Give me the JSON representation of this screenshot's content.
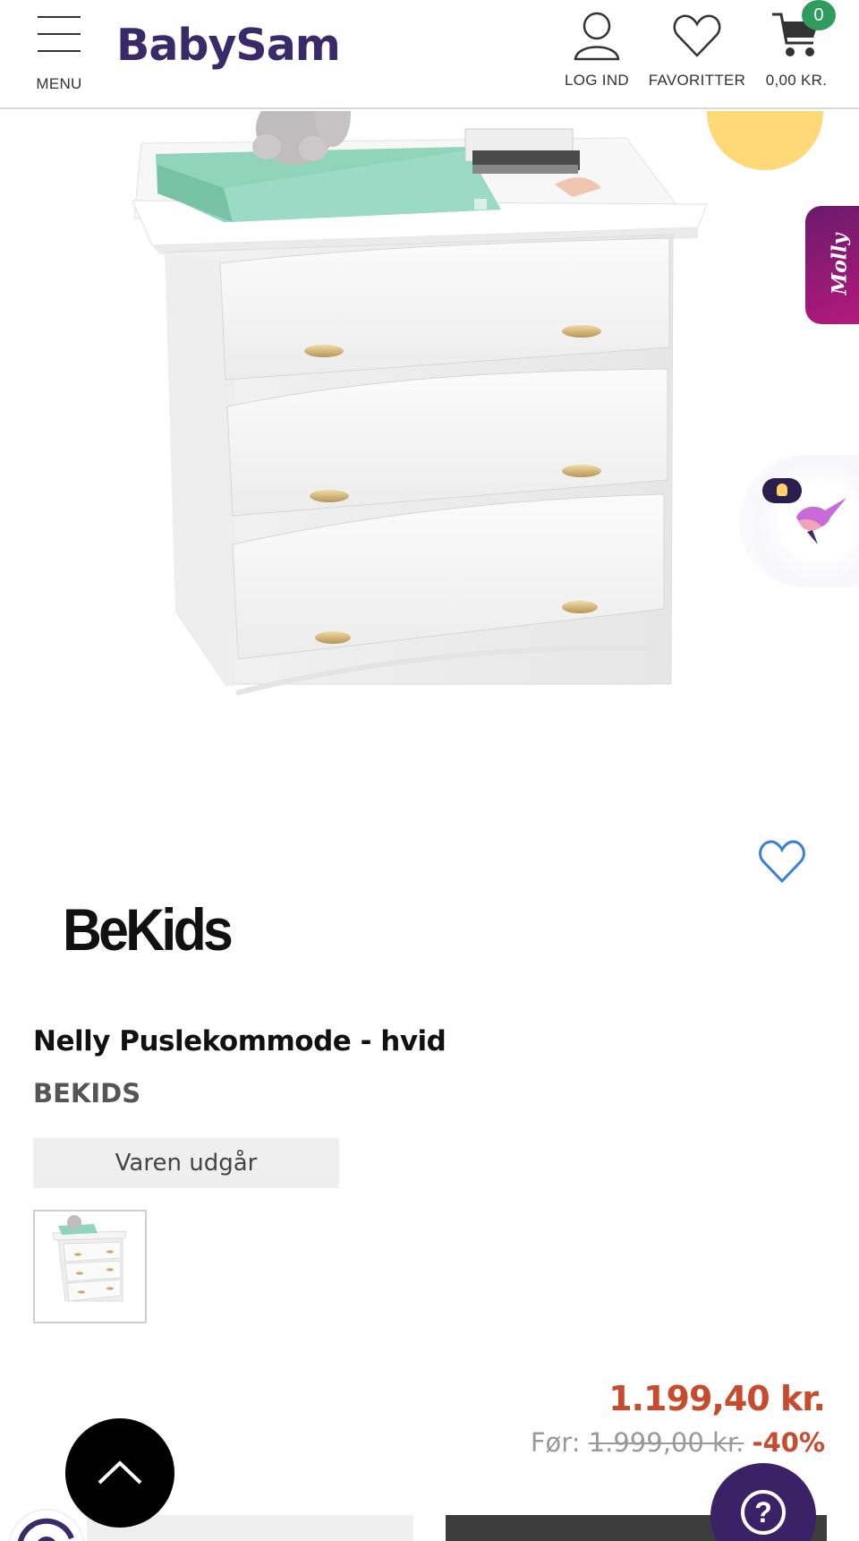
{
  "header": {
    "menu_label": "MENU",
    "logo_text": "BabySam",
    "login_label": "LOG IND",
    "favorites_label": "FAVORITTER",
    "cart_total": "0,00 KR.",
    "cart_count": "0"
  },
  "widgets": {
    "molly_label": "Molly"
  },
  "product": {
    "brand_logo_text": "BeKids",
    "title": "Nelly Puslekommode - hvid",
    "brand": "BEKIDS",
    "status": "Varen udgår",
    "price_current": "1.199,40 kr.",
    "price_before_label": "Før:",
    "price_before": "1.999,00 kr.",
    "discount": "-40%"
  },
  "colors": {
    "brand_purple": "#3a2a6a",
    "price_red": "#c84b2e",
    "cart_badge_green": "#2f9b5c",
    "molly_magenta": "#b3197c"
  },
  "icons": {
    "menu": "hamburger-icon",
    "login": "user-icon",
    "favorites": "heart-icon",
    "cart": "cart-icon",
    "scroll_top": "chevron-up-icon",
    "help": "question-icon"
  }
}
